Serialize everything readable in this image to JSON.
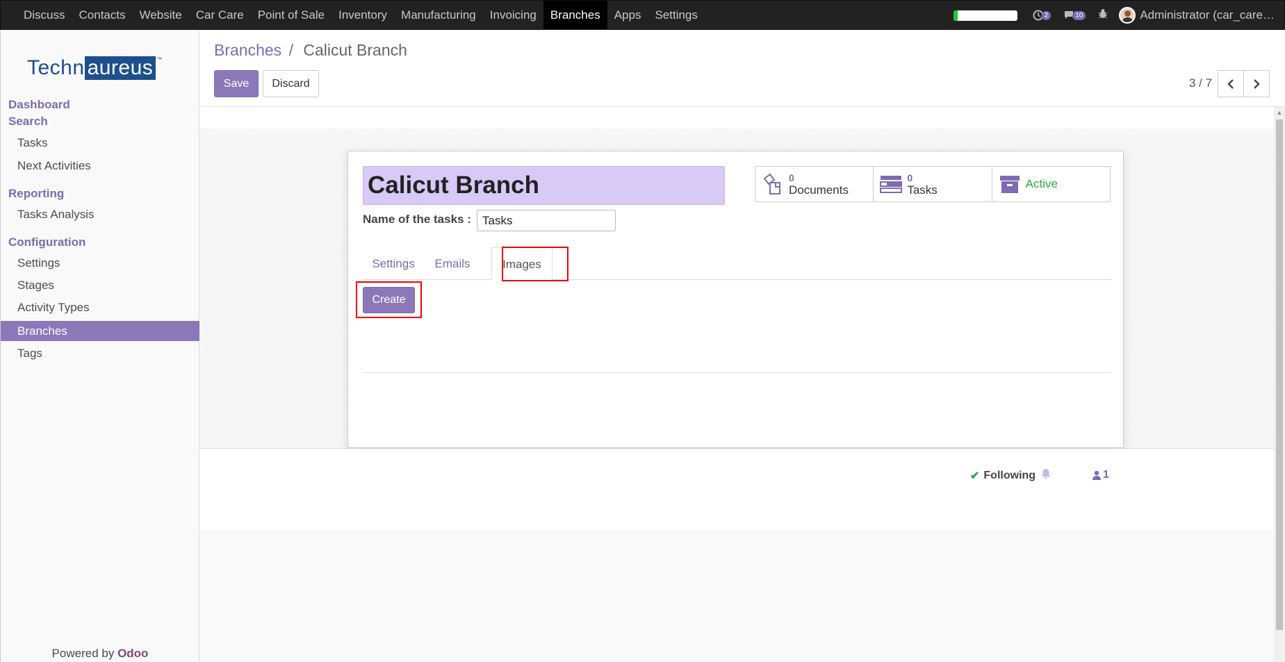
{
  "topmenu": {
    "items": [
      "Discuss",
      "Contacts",
      "Website",
      "Car Care",
      "Point of Sale",
      "Inventory",
      "Manufacturing",
      "Invoicing",
      "Branches",
      "Apps",
      "Settings"
    ],
    "active": "Branches",
    "activity_count": "2",
    "message_count": "10",
    "user_name": "Administrator (car_care…"
  },
  "sidebar": {
    "logo_part1": "Techn",
    "logo_part2": "aureus",
    "logo_tm": "™",
    "dashboard": "Dashboard",
    "search": "Search",
    "tasks": "Tasks",
    "next_activities": "Next Activities",
    "reporting": "Reporting",
    "tasks_analysis": "Tasks Analysis",
    "configuration": "Configuration",
    "settings": "Settings",
    "stages": "Stages",
    "activity_types": "Activity Types",
    "branches": "Branches",
    "tags": "Tags",
    "powered_by": "Powered by",
    "powered_brand": "Odoo"
  },
  "control_panel": {
    "breadcrumb_root": "Branches",
    "breadcrumb_sep": "/",
    "breadcrumb_current": "Calicut Branch",
    "save_label": "Save",
    "discard_label": "Discard",
    "pager": "3 / 7"
  },
  "form": {
    "name": "Calicut Branch",
    "tasks_label": "Name of the tasks :",
    "tasks_value": "Tasks",
    "stats": {
      "documents_count": "0",
      "documents_label": "Documents",
      "tasks_count": "0",
      "tasks_label": "Tasks",
      "active_label": "Active"
    },
    "tabs": [
      "Settings",
      "Emails",
      "Images"
    ],
    "active_tab": "Images",
    "create_label": "Create"
  },
  "chatter": {
    "following_label": "Following",
    "followers_count": "1"
  },
  "colors": {
    "primary": "#7c6bb0",
    "primary_btn": "#8c77b8",
    "highlight": "#e00000",
    "active_green": "#28a745"
  }
}
